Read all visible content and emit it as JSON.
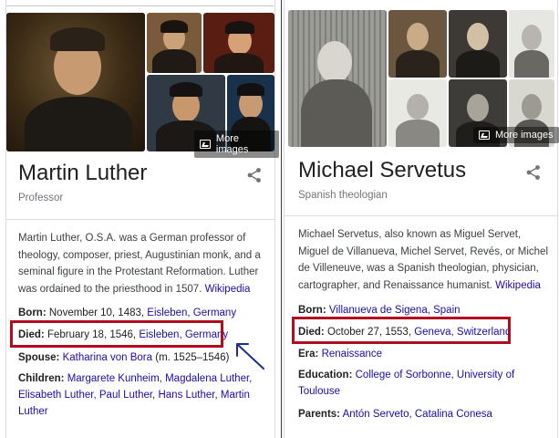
{
  "left": {
    "name": "Martin Luther",
    "subtitle": "Professor",
    "more_images": "More images",
    "description_text": "Martin Luther, O.S.A. was a German professor of theology, composer, priest, Augustinian monk, and a seminal figure in the Protestant Reformation. Luther was ordained to the priesthood in 1507.",
    "description_link": "Wikipedia",
    "born": {
      "label": "Born:",
      "text": "November 10, 1483,",
      "link": "Eisleben, Germany"
    },
    "died": {
      "label": "Died:",
      "text": "February 18, 1546,",
      "link1": "Eisleben,",
      "link2": "Germany"
    },
    "spouse": {
      "label": "Spouse:",
      "link": "Katharina von Bora",
      "text": "(m. 1525–1546)"
    },
    "children": {
      "label": "Children:",
      "link1": "Margarete Kunheim,",
      "link2": "Magdalena Luther,",
      "link3": "Elisabeth Luther,",
      "link4": "Paul Luther,",
      "link5": "Hans Luther,",
      "link6": "Martin",
      "link7": "Luther"
    }
  },
  "right": {
    "name": "Michael Servetus",
    "subtitle": "Spanish theologian",
    "more_images": "More images",
    "description_text": "Michael Servetus, also known as Miguel Servet, Miguel de Villanueva, Michel Servet, Revés, or Michel de Villeneuve, was a Spanish theologian, physician, cartographer, and Renaissance humanist.",
    "description_link": "Wikipedia",
    "born": {
      "label": "Born:",
      "link": "Villanueva de Sigena, Spain"
    },
    "died": {
      "label": "Died:",
      "text": "October 27, 1553,",
      "link1": "Geneva,",
      "link2": "Switzerland"
    },
    "era": {
      "label": "Era:",
      "link": "Renaissance"
    },
    "education": {
      "label": "Education:",
      "link1": "College of Sorbonne,",
      "link2": "University of",
      "link3": "Toulouse"
    },
    "parents": {
      "label": "Parents:",
      "link": "Antón Serveto, Catalina Conesa"
    }
  },
  "colors": {
    "link": "#1a0dab",
    "highlight": "#b00d1f",
    "arrow": "#1f2a9c"
  },
  "icons": [
    "image-gallery-icon",
    "share-icon",
    "arrow-annotation"
  ]
}
